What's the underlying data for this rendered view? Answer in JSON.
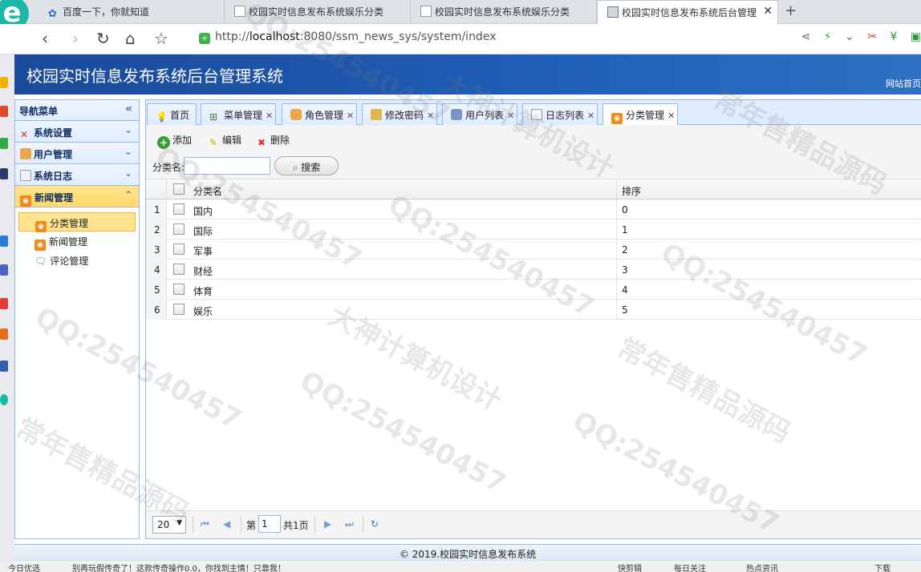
{
  "browser": {
    "tabs": [
      {
        "title": "百度一下，你就知道"
      },
      {
        "title": "校园实时信息发布系统娱乐分类"
      },
      {
        "title": "校园实时信息发布系统娱乐分类"
      },
      {
        "title": "校园实时信息发布系统后台管理"
      }
    ],
    "url_prefix": "http://",
    "url_host": "localhost",
    "url_rest": ":8080/ssm_news_sys/system/index"
  },
  "app": {
    "title": "校园实时信息发布系统后台管理系统",
    "site_home": "网站首页"
  },
  "sidebar": {
    "title": "导航菜单",
    "groups": [
      {
        "label": "系统设置"
      },
      {
        "label": "用户管理"
      },
      {
        "label": "系统日志"
      },
      {
        "label": "新闻管理"
      }
    ],
    "subitems": [
      {
        "label": "分类管理"
      },
      {
        "label": "新闻管理"
      },
      {
        "label": "评论管理"
      }
    ]
  },
  "tabs": [
    {
      "label": "首页"
    },
    {
      "label": "菜单管理"
    },
    {
      "label": "角色管理"
    },
    {
      "label": "修改密码"
    },
    {
      "label": "用户列表"
    },
    {
      "label": "日志列表"
    },
    {
      "label": "分类管理"
    }
  ],
  "toolbar": {
    "add": "添加",
    "edit": "编辑",
    "delete": "删除",
    "search_label": "分类名:",
    "search_button": "搜索"
  },
  "grid": {
    "headers": {
      "name": "分类名",
      "sort": "排序"
    },
    "rows": [
      {
        "num": "1",
        "name": "国内",
        "sort": "0"
      },
      {
        "num": "2",
        "name": "国际",
        "sort": "1"
      },
      {
        "num": "3",
        "name": "军事",
        "sort": "2"
      },
      {
        "num": "4",
        "name": "财经",
        "sort": "3"
      },
      {
        "num": "5",
        "name": "体育",
        "sort": "4"
      },
      {
        "num": "6",
        "name": "娱乐",
        "sort": "5"
      }
    ]
  },
  "pager": {
    "page_size": "20",
    "page_prefix": "第",
    "page_value": "1",
    "page_total": "共1页"
  },
  "footer": "© 2019.校园实时信息发布系统",
  "statusbar": {
    "left": "今日优选",
    "news": "别再玩假传奇了！这款传奇操作0.0，你找到主情！只靠我！",
    "items": [
      "快剪辑",
      "每日关注",
      "热点资讯",
      "下载"
    ]
  },
  "watermarks": [
    "QQ:254540457",
    "大神计算机设计",
    "常年售精品源码"
  ]
}
